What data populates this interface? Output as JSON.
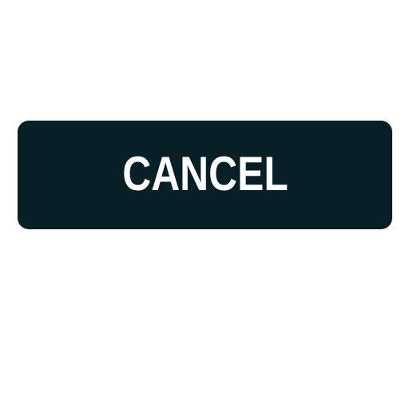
{
  "button": {
    "label": "CANCEL",
    "background": "#072027",
    "text_color": "#ffffff"
  }
}
